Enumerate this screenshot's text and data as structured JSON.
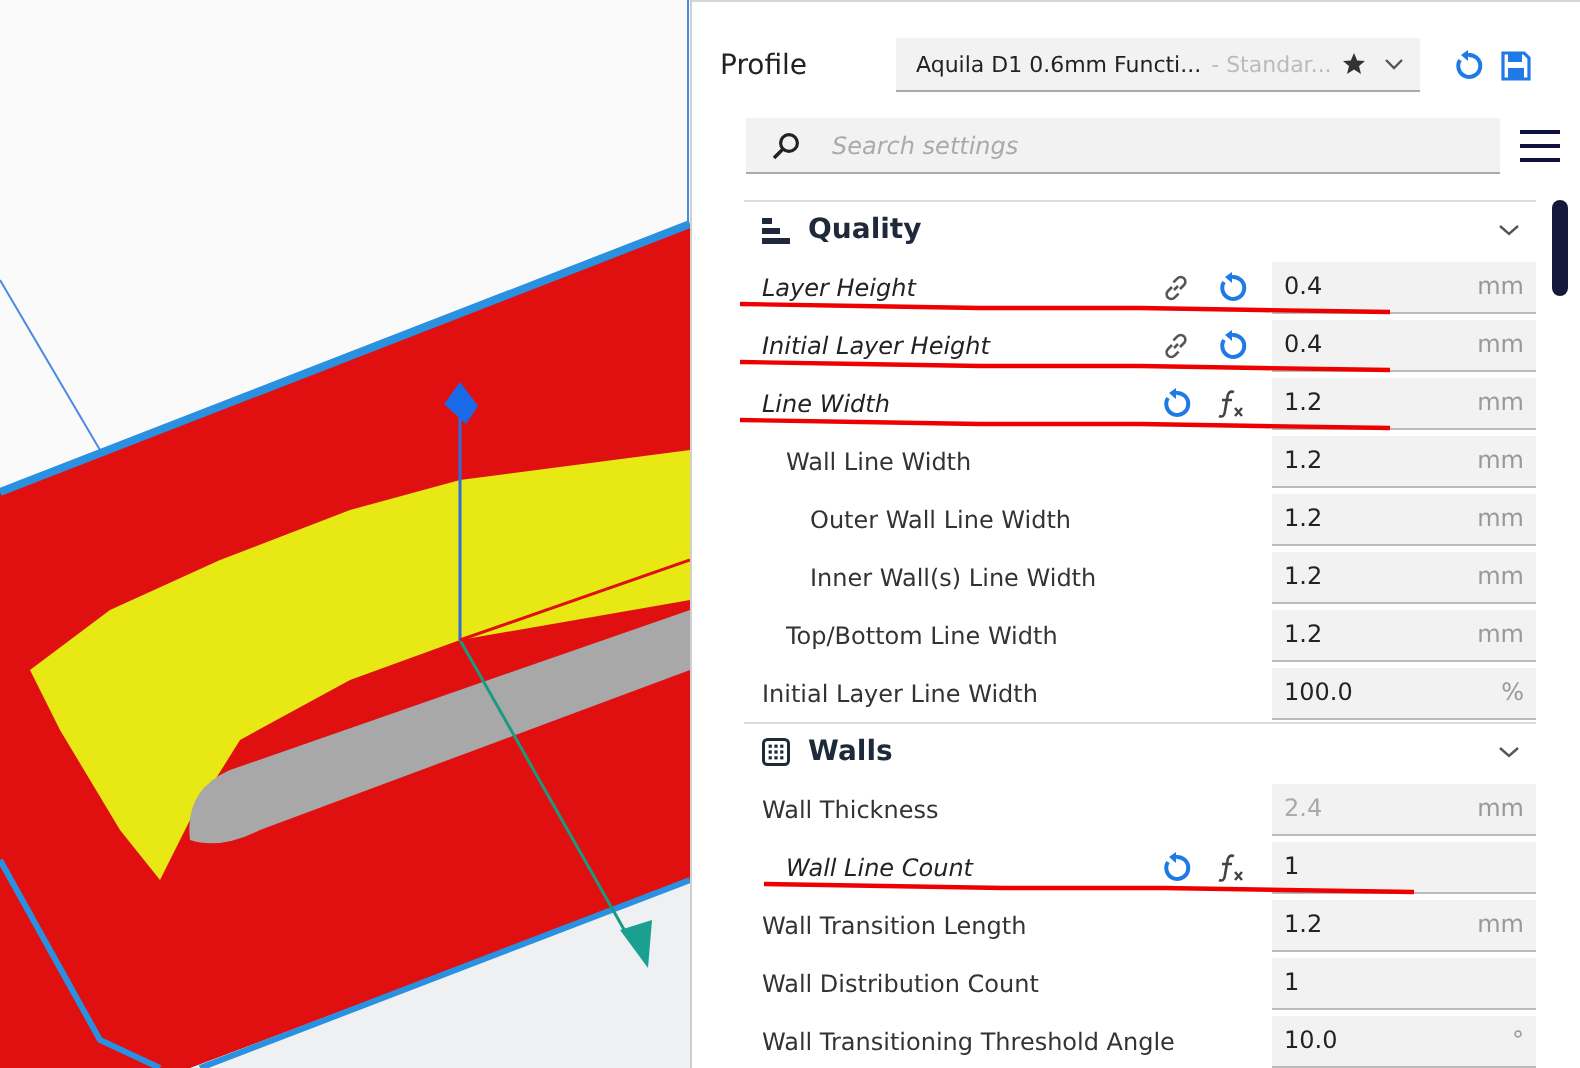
{
  "profile": {
    "label": "Profile",
    "name": "Aquila D1 0.6mm Functi...",
    "quality": "- Standar...",
    "favorite": true
  },
  "search": {
    "placeholder": "Search settings"
  },
  "sections": [
    {
      "title": "Quality",
      "expanded": true,
      "settings": [
        {
          "label": "Layer Height",
          "modified": true,
          "underlined": true,
          "linked": true,
          "resettable": true,
          "value": "0.4",
          "unit": "mm",
          "disabled": false
        },
        {
          "label": "Initial Layer Height",
          "modified": true,
          "underlined": true,
          "linked": true,
          "resettable": true,
          "value": "0.4",
          "unit": "mm",
          "disabled": false
        },
        {
          "label": "Line Width",
          "modified": true,
          "underlined": true,
          "resettable": true,
          "formula": true,
          "value": "1.2",
          "unit": "mm",
          "disabled": false,
          "children": [
            {
              "label": "Wall Line Width",
              "modified": false,
              "underlined": false,
              "value": "1.2",
              "unit": "mm",
              "disabled": false,
              "children": [
                {
                  "label": "Outer Wall Line Width",
                  "modified": false,
                  "underlined": false,
                  "value": "1.2",
                  "unit": "mm",
                  "disabled": false
                },
                {
                  "label": "Inner Wall(s) Line Width",
                  "modified": false,
                  "underlined": false,
                  "value": "1.2",
                  "unit": "mm",
                  "disabled": false
                }
              ]
            },
            {
              "label": "Top/Bottom Line Width",
              "modified": false,
              "underlined": false,
              "value": "1.2",
              "unit": "mm",
              "disabled": false
            }
          ]
        },
        {
          "label": "Initial Layer Line Width",
          "modified": false,
          "underlined": false,
          "value": "100.0",
          "unit": "%",
          "disabled": false
        }
      ]
    },
    {
      "title": "Walls",
      "expanded": true,
      "settings": [
        {
          "label": "Wall Thickness",
          "modified": false,
          "underlined": false,
          "value": "2.4",
          "unit": "mm",
          "disabled": true,
          "children": [
            {
              "label": "Wall Line Count",
              "modified": true,
              "underlined": true,
              "resettable": true,
              "formula": true,
              "value": "1",
              "disabled": false
            }
          ]
        },
        {
          "label": "Wall Transition Length",
          "modified": false,
          "underlined": false,
          "value": "1.2",
          "unit": "mm",
          "disabled": false
        },
        {
          "label": "Wall Distribution Count",
          "modified": false,
          "underlined": false,
          "value": "1",
          "disabled": false
        },
        {
          "label": "Wall Transitioning Threshold Angle",
          "modified": false,
          "underlined": false,
          "value": "10.0",
          "unit": "°",
          "disabled": false
        }
      ]
    }
  ]
}
